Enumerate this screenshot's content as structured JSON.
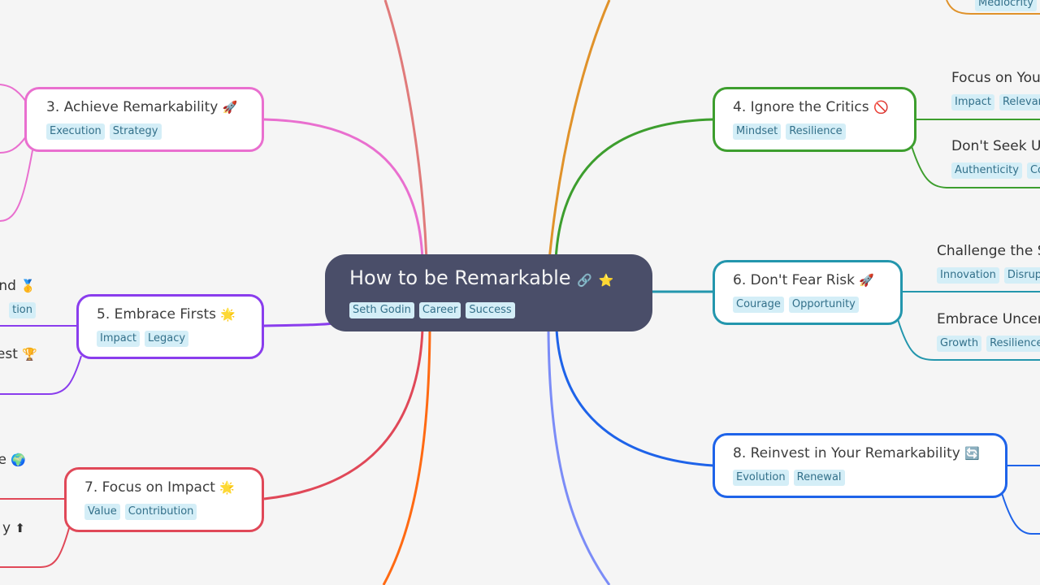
{
  "root": {
    "title": "How to be Remarkable",
    "icons": [
      "🔗",
      "⭐"
    ],
    "tags": [
      "Seth Godin",
      "Career",
      "Success"
    ]
  },
  "branches": [
    {
      "id": "b3",
      "title": "3. Achieve Remarkability",
      "icon": "🚀",
      "tags": [
        "Execution",
        "Strategy"
      ],
      "color": "#e96fcf"
    },
    {
      "id": "b5",
      "title": "5. Embrace Firsts",
      "icon": "🌟",
      "tags": [
        "Impact",
        "Legacy"
      ],
      "color": "#8a3ded"
    },
    {
      "id": "b7",
      "title": "7. Focus on Impact",
      "icon": "🌟",
      "tags": [
        "Value",
        "Contribution"
      ],
      "color": "#e04858"
    },
    {
      "id": "b4",
      "title": "4. Ignore the Critics",
      "icon": "🚫",
      "tags": [
        "Mindset",
        "Resilience"
      ],
      "color": "#3d9e2e"
    },
    {
      "id": "b6",
      "title": "6. Don't Fear Risk",
      "icon": "🚀",
      "tags": [
        "Courage",
        "Opportunity"
      ],
      "color": "#2396ad"
    },
    {
      "id": "b8",
      "title": "8. Reinvest in Your Remarkability",
      "icon": "🔄",
      "tags": [
        "Evolution",
        "Renewal"
      ],
      "color": "#1e63e9"
    }
  ],
  "leaves": [
    {
      "title": "Focus on You",
      "tags": [
        "Impact",
        "Relevan"
      ]
    },
    {
      "title": "Don't Seek Ur",
      "tags": [
        "Authenticity",
        "Co"
      ]
    },
    {
      "title": "Challenge the S",
      "tags": [
        "Innovation",
        "Disrup"
      ]
    },
    {
      "title": "Embrace Uncer",
      "tags": [
        "Growth",
        "Resilience"
      ]
    },
    {
      "title": "nd",
      "icon": "🥇",
      "tags": [
        "tion"
      ]
    },
    {
      "title": "est",
      "icon": "🏆",
      "tags": []
    },
    {
      "title": "e",
      "icon": "🌍",
      "tags": []
    },
    {
      "title": "y",
      "icon": "⬆",
      "tags": []
    },
    {
      "title": "",
      "tags": [
        "Mediocrity"
      ]
    }
  ],
  "edge_colors": {
    "top_left_offscreen": "#e07a7a",
    "top_right_offscreen": "#e0922a",
    "bottom_left_offscreen": "#ff6a13",
    "bottom_right_offscreen": "#7b8cf7"
  }
}
